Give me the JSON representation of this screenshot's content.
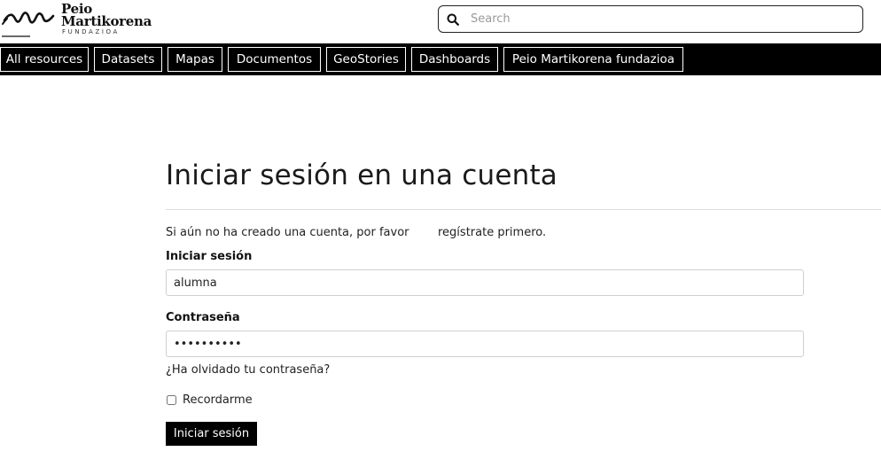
{
  "brand": {
    "name_line1": "Peio",
    "name_line2": "Martikorena",
    "subtitle": "FUNDAZIOA",
    "logo_icon": "signature-wave-icon"
  },
  "search": {
    "placeholder": "Search",
    "value": "",
    "icon": "search-icon"
  },
  "nav": {
    "items": [
      {
        "label": "All resources"
      },
      {
        "label": "Datasets"
      },
      {
        "label": "Mapas"
      },
      {
        "label": "Documentos"
      },
      {
        "label": "GeoStories"
      },
      {
        "label": "Dashboards"
      },
      {
        "label": "Peio Martikorena fundazioa"
      }
    ]
  },
  "login": {
    "title": "Iniciar sesión en una cuenta",
    "intro_text": "Si aún no ha creado una cuenta, por favor",
    "signup_link": "regístrate primero.",
    "username_label": "Iniciar sesión",
    "username_value": "alumna",
    "password_label": "Contraseña",
    "password_value": "••••••••••",
    "forgot_link": "¿Ha olvidado tu contraseña?",
    "remember_label": "Recordarme",
    "remember_checked": false,
    "submit_label": "Iniciar sesión"
  },
  "colors": {
    "navbar_bg": "#000000",
    "nav_text": "#ffffff",
    "button_bg": "#000000",
    "page_bg": "#ffffff"
  }
}
